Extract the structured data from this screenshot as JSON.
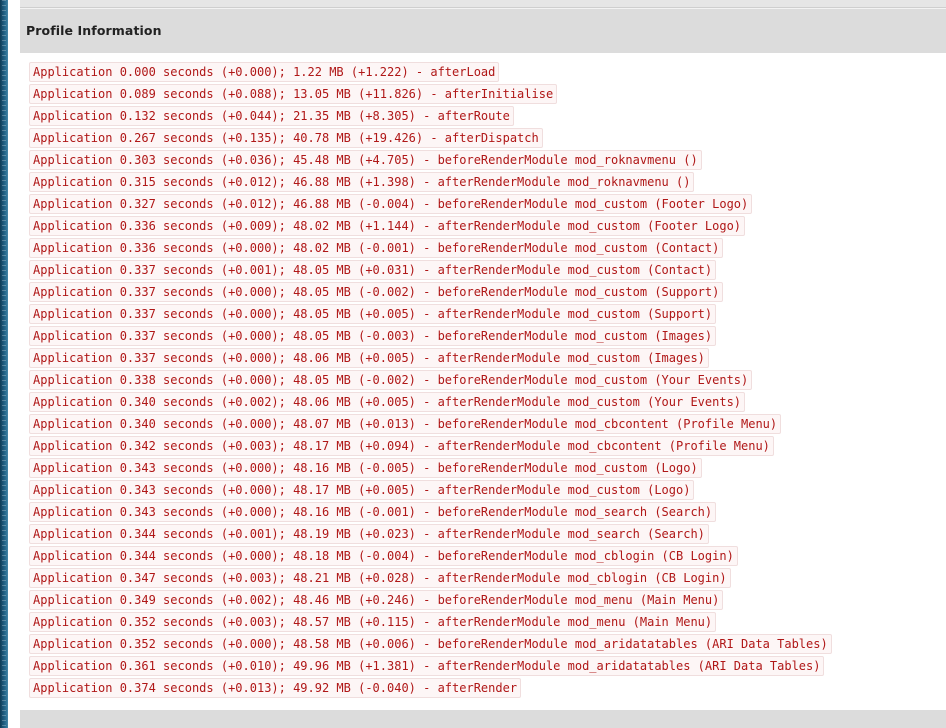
{
  "panel": {
    "title": "Profile Information"
  },
  "colors": {
    "log_text": "#b01717",
    "header_bg": "#dcdcdc"
  },
  "entries": [
    "Application 0.000 seconds (+0.000); 1.22 MB (+1.222) - afterLoad",
    "Application 0.089 seconds (+0.088); 13.05 MB (+11.826) - afterInitialise",
    "Application 0.132 seconds (+0.044); 21.35 MB (+8.305) - afterRoute",
    "Application 0.267 seconds (+0.135); 40.78 MB (+19.426) - afterDispatch",
    "Application 0.303 seconds (+0.036); 45.48 MB (+4.705) - beforeRenderModule mod_roknavmenu ()",
    "Application 0.315 seconds (+0.012); 46.88 MB (+1.398) - afterRenderModule mod_roknavmenu ()",
    "Application 0.327 seconds (+0.012); 46.88 MB (-0.004) - beforeRenderModule mod_custom (Footer Logo)",
    "Application 0.336 seconds (+0.009); 48.02 MB (+1.144) - afterRenderModule mod_custom (Footer Logo)",
    "Application 0.336 seconds (+0.000); 48.02 MB (-0.001) - beforeRenderModule mod_custom (Contact)",
    "Application 0.337 seconds (+0.001); 48.05 MB (+0.031) - afterRenderModule mod_custom (Contact)",
    "Application 0.337 seconds (+0.000); 48.05 MB (-0.002) - beforeRenderModule mod_custom (Support)",
    "Application 0.337 seconds (+0.000); 48.05 MB (+0.005) - afterRenderModule mod_custom (Support)",
    "Application 0.337 seconds (+0.000); 48.05 MB (-0.003) - beforeRenderModule mod_custom (Images)",
    "Application 0.337 seconds (+0.000); 48.06 MB (+0.005) - afterRenderModule mod_custom (Images)",
    "Application 0.338 seconds (+0.000); 48.05 MB (-0.002) - beforeRenderModule mod_custom (Your Events)",
    "Application 0.340 seconds (+0.002); 48.06 MB (+0.005) - afterRenderModule mod_custom (Your Events)",
    "Application 0.340 seconds (+0.000); 48.07 MB (+0.013) - beforeRenderModule mod_cbcontent (Profile Menu)",
    "Application 0.342 seconds (+0.003); 48.17 MB (+0.094) - afterRenderModule mod_cbcontent (Profile Menu)",
    "Application 0.343 seconds (+0.000); 48.16 MB (-0.005) - beforeRenderModule mod_custom (Logo)",
    "Application 0.343 seconds (+0.000); 48.17 MB (+0.005) - afterRenderModule mod_custom (Logo)",
    "Application 0.343 seconds (+0.000); 48.16 MB (-0.001) - beforeRenderModule mod_search (Search)",
    "Application 0.344 seconds (+0.001); 48.19 MB (+0.023) - afterRenderModule mod_search (Search)",
    "Application 0.344 seconds (+0.000); 48.18 MB (-0.004) - beforeRenderModule mod_cblogin (CB Login)",
    "Application 0.347 seconds (+0.003); 48.21 MB (+0.028) - afterRenderModule mod_cblogin (CB Login)",
    "Application 0.349 seconds (+0.002); 48.46 MB (+0.246) - beforeRenderModule mod_menu (Main Menu)",
    "Application 0.352 seconds (+0.003); 48.57 MB (+0.115) - afterRenderModule mod_menu (Main Menu)",
    "Application 0.352 seconds (+0.000); 48.58 MB (+0.006) - beforeRenderModule mod_aridatatables (ARI Data Tables)",
    "Application 0.361 seconds (+0.010); 49.96 MB (+1.381) - afterRenderModule mod_aridatatables (ARI Data Tables)",
    "Application 0.374 seconds (+0.013); 49.92 MB (-0.040) - afterRender"
  ]
}
